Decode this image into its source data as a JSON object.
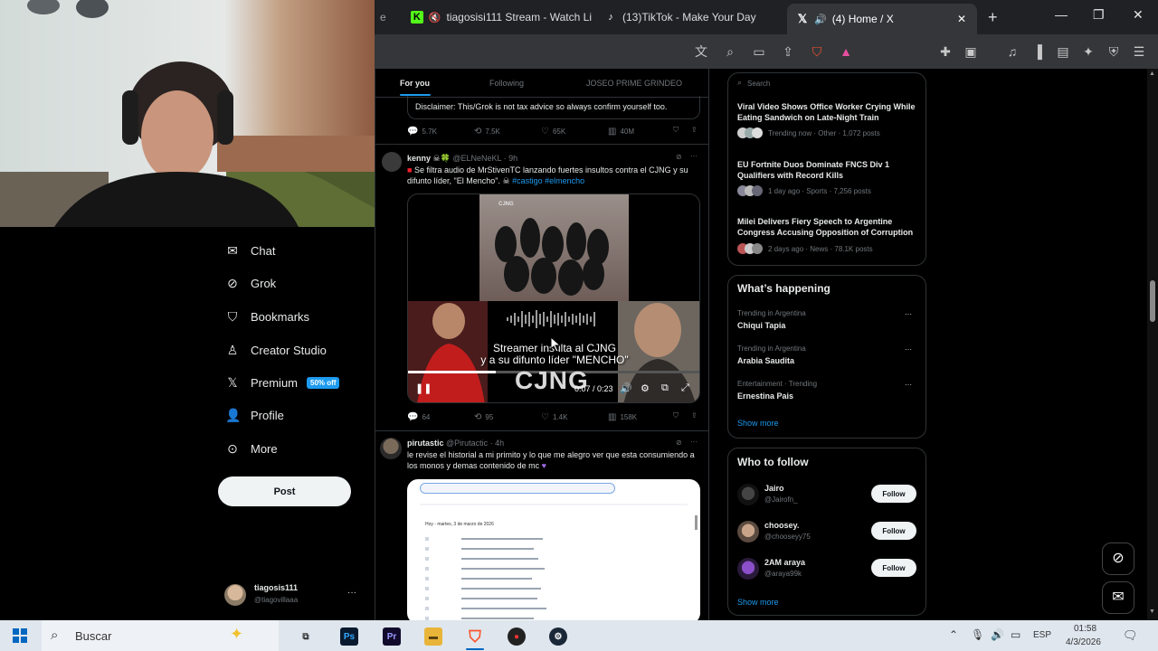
{
  "browser": {
    "tabs": [
      {
        "title": "tiagosisi111 Stream - Watch Li",
        "icon": "kick-icon"
      },
      {
        "title": "(13)TikTok - Make Your Day",
        "icon": "tiktok-icon"
      },
      {
        "title": "(4) Home / X",
        "icon": "x-icon"
      }
    ],
    "new_tab": "+"
  },
  "left_nav": {
    "items": [
      {
        "label": "Chat",
        "icon": "mail-icon"
      },
      {
        "label": "Grok",
        "icon": "grok-icon"
      },
      {
        "label": "Bookmarks",
        "icon": "bookmark-icon"
      },
      {
        "label": "Creator Studio",
        "icon": "creator-icon"
      },
      {
        "label": "Premium",
        "icon": "x-icon"
      },
      {
        "label": "Profile",
        "icon": "person-icon"
      },
      {
        "label": "More",
        "icon": "more-icon"
      }
    ],
    "premium_badge": "50% off",
    "post_label": "Post",
    "account": {
      "name": "tiagosis111",
      "handle": "@tiagovillaaa",
      "more": "···"
    }
  },
  "feed": {
    "tabs": [
      "For you",
      "Following",
      "JOSEO PRIME GRINDEO"
    ],
    "disclaimer": "Disclaimer: This/Grok is not tax advice so always confirm yourself too.",
    "stats_prev": {
      "replies": "5.7K",
      "reposts": "7.5K",
      "likes": "65K",
      "views": "40M"
    },
    "tweet1": {
      "name": "kenny",
      "handle": "@ELNeNeKL · 9h",
      "text": "Se filtra audio de MrStivenTC lanzando fuertes insultos contra el CJNG y su difunto líder, \"El Mencho\".",
      "hashtags": "#castigo #elmencho",
      "video": {
        "caption_line1": "Streamer insulta al CJNG",
        "caption_line2": "y a su difunto líder \"MENCHO\"",
        "logo": "CJNG",
        "time": "0:07 / 0:23",
        "vest_text": "CJNG"
      },
      "stats": {
        "replies": "64",
        "reposts": "95",
        "likes": "1.4K",
        "views": "158K"
      }
    },
    "tweet2": {
      "name": "pirutastic",
      "handle": "@Pirutactic · 4h",
      "text": "le revise el historial a mi primito y lo que me alegro ver que esta consumiendo a los monos y demas contenido de mc",
      "screenshot_title": "Hoy - martes, 3 de marzo de 2026"
    }
  },
  "right": {
    "search_placeholder": "Search",
    "trends_top": [
      {
        "title": "Viral Video Shows Office Worker Crying While Eating Sandwich on Late-Night Train",
        "meta": "Trending now · Other · 1,072 posts"
      },
      {
        "title": "EU Fortnite Duos Dominate FNCS Div 1 Qualifiers with Record Kills",
        "meta": "1 day ago · Sports · 7,256 posts"
      },
      {
        "title": "Milei Delivers Fiery Speech to Argentine Congress Accusing Opposition of Corruption",
        "meta": "2 days ago · News · 78.1K posts"
      }
    ],
    "whats_happening": {
      "title": "What’s happening",
      "items": [
        {
          "context": "Trending in Argentina",
          "name": "Chiqui Tapia"
        },
        {
          "context": "Trending in Argentina",
          "name": "Arabia Saudita"
        },
        {
          "context": "Entertainment · Trending",
          "name": "Ernestina Pais"
        }
      ],
      "show_more": "Show more"
    },
    "who_to_follow": {
      "title": "Who to follow",
      "users": [
        {
          "name": "Jairo",
          "handle": "@Jairofn_"
        },
        {
          "name": "choosey.",
          "handle": "@chooseyy75"
        },
        {
          "name": "2AM araya",
          "handle": "@araya99k"
        }
      ],
      "follow_label": "Follow",
      "show_more": "Show more"
    }
  },
  "taskbar": {
    "search_label": "Buscar",
    "lang": "ESP",
    "time": "01:58",
    "date": "4/3/2026"
  }
}
